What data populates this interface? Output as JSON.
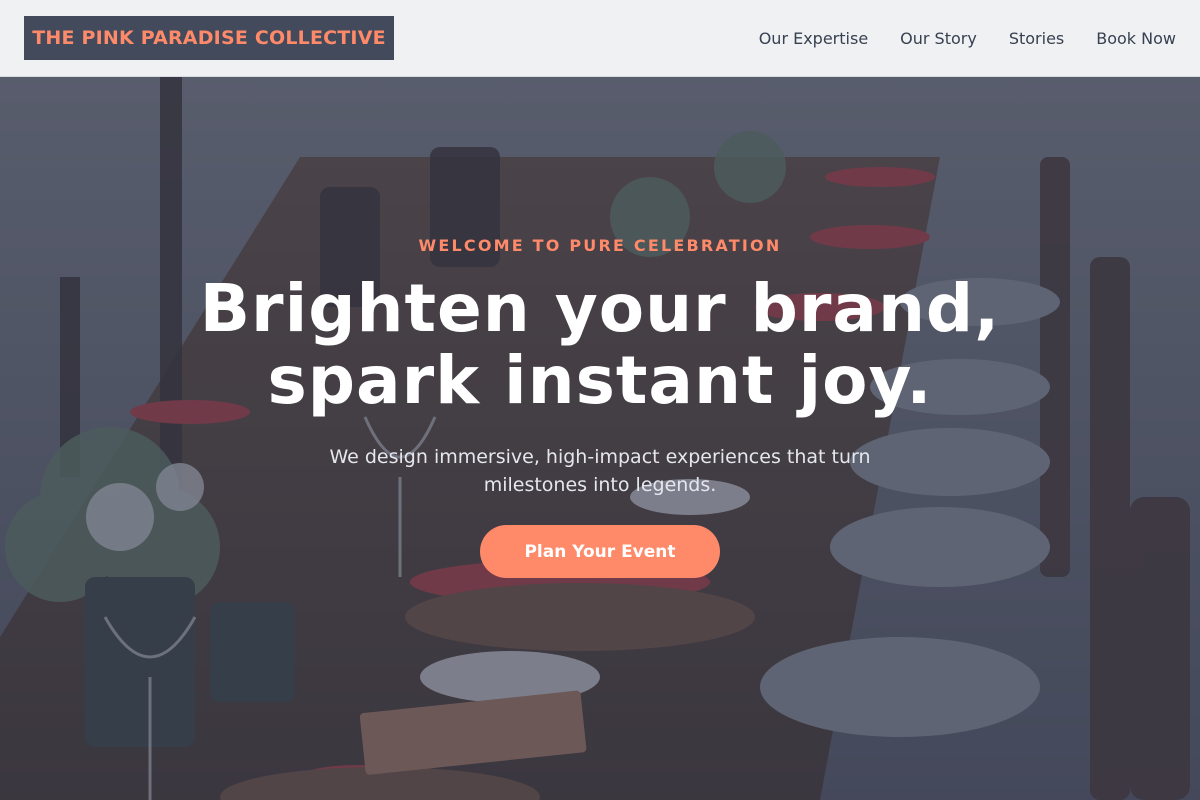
{
  "header": {
    "brand": "THE PINK PARADISE COLLECTIVE",
    "nav": [
      "Our Expertise",
      "Our Story",
      "Stories",
      "Book Now"
    ]
  },
  "hero": {
    "eyebrow": "WELCOME TO PURE CELEBRATION",
    "headline_line1": "Brighten your brand,",
    "headline_line2": "spark instant joy.",
    "subtext": "We design immersive, high-impact experiences that turn milestones into legends.",
    "cta_label": "Plan Your Event",
    "background": "photo-outdoor-dinner-table"
  },
  "colors": {
    "accent": "#fe8a6a",
    "brand_box": "#424a5b",
    "header_bg": "#f0f1f3",
    "nav_text": "#374151"
  }
}
